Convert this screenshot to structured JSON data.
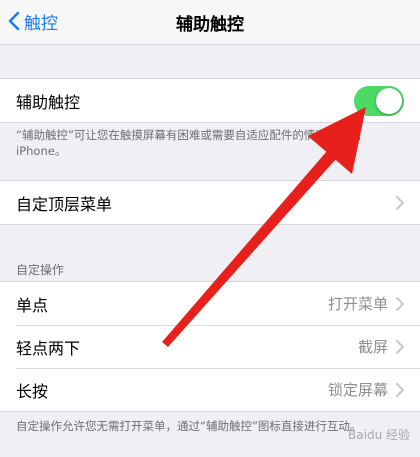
{
  "navbar": {
    "back_label": "触控",
    "title": "辅助触控"
  },
  "assistive_touch": {
    "label": "辅助触控",
    "toggle_on": true,
    "description": "“辅助触控”可让您在触摸屏幕有困难或需要自适应配件的情况下使用 iPhone。"
  },
  "customize_menu": {
    "label": "自定顶层菜单"
  },
  "custom_actions": {
    "header": "自定操作",
    "rows": [
      {
        "label": "单点",
        "value": "打开菜单"
      },
      {
        "label": "轻点两下",
        "value": "截屏"
      },
      {
        "label": "长按",
        "value": "锁定屏幕"
      }
    ],
    "footer": "自定操作允许您无需打开菜单，通过“辅助触控”图标直接进行互动。"
  },
  "watermark": "Baidu 经验",
  "colors": {
    "accent": "#1a7cf5",
    "toggle_on": "#4cd964",
    "arrow": "#e8201c"
  }
}
